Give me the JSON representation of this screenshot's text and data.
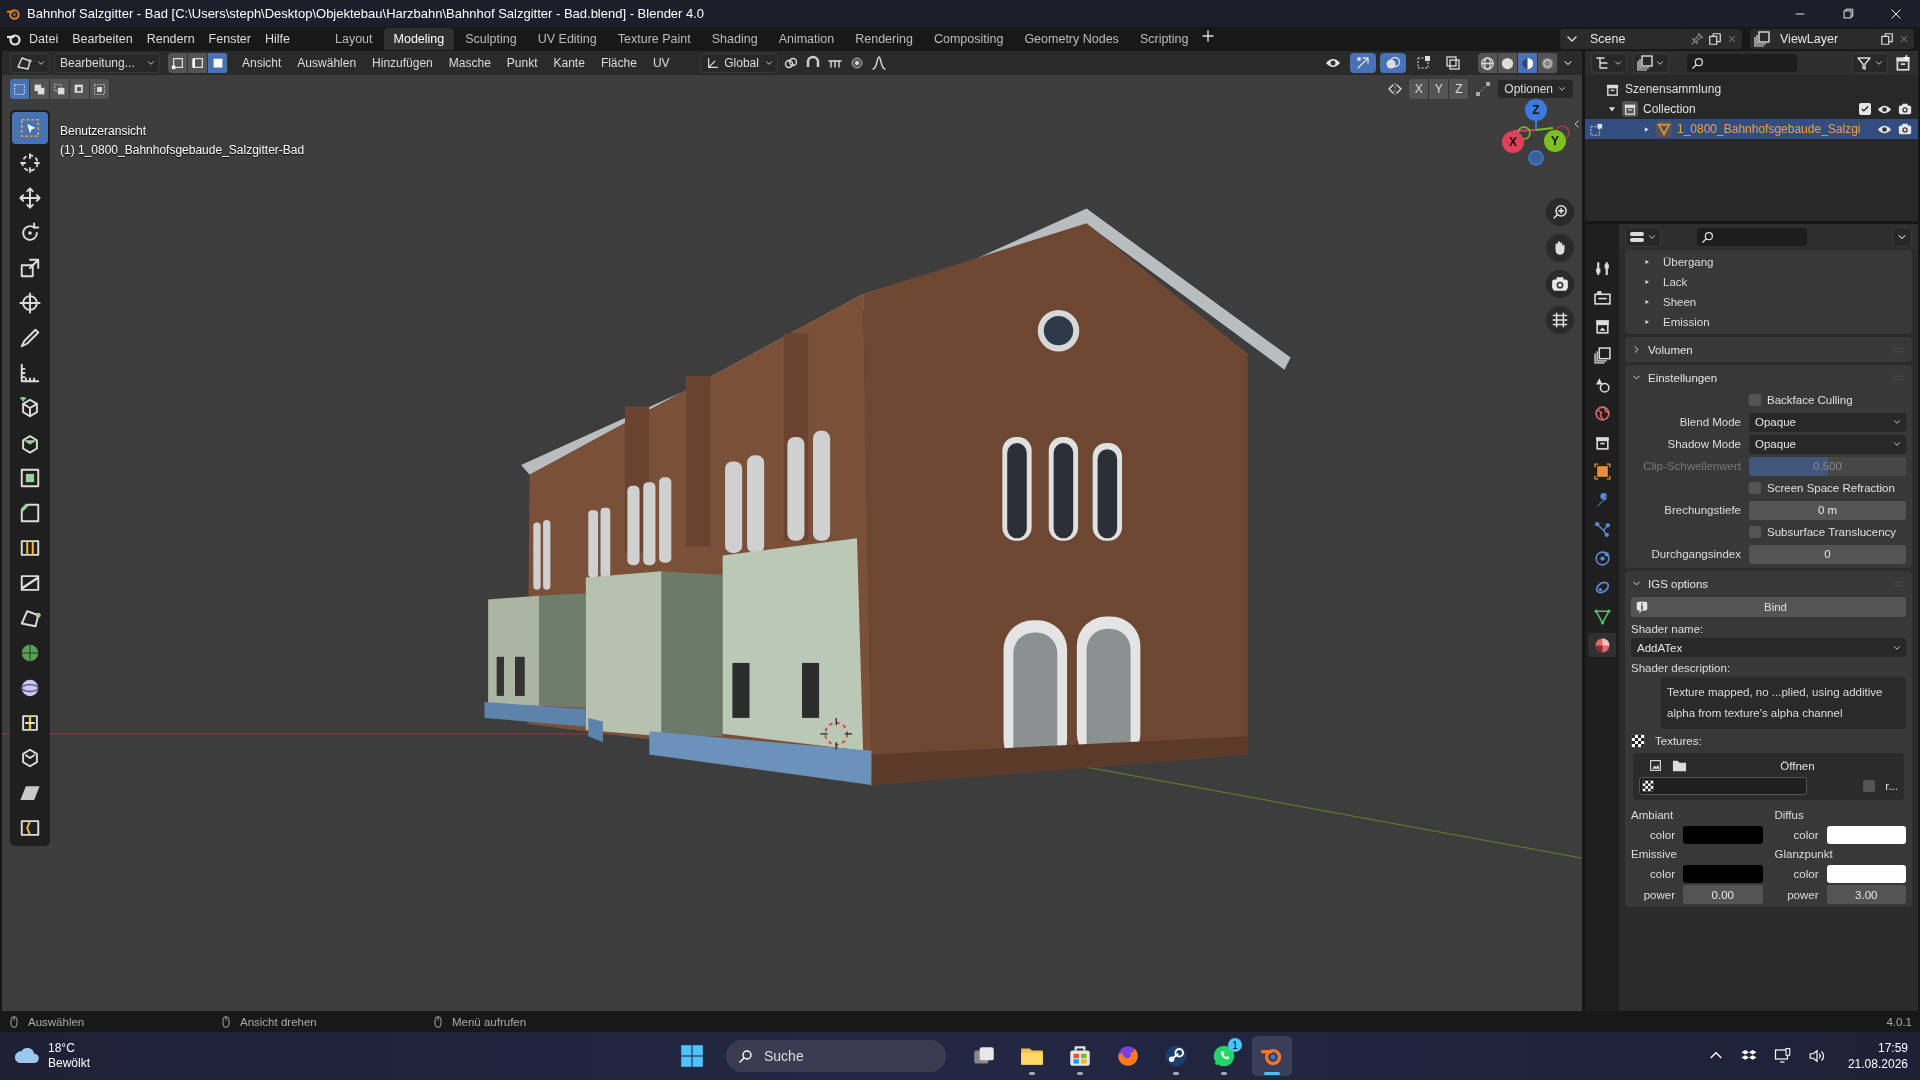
{
  "window": {
    "title": "Bahnhof Salzgitter - Bad [C:\\Users\\steph\\Desktop\\Objektebau\\Harzbahn\\Bahnhof Salzgitter - Bad.blend] - Blender 4.0"
  },
  "menu": [
    "Datei",
    "Bearbeiten",
    "Rendern",
    "Fenster",
    "Hilfe"
  ],
  "workspaces": [
    {
      "label": "Layout",
      "selected": false
    },
    {
      "label": "Modeling",
      "selected": true
    },
    {
      "label": "Sculpting",
      "selected": false
    },
    {
      "label": "UV Editing",
      "selected": false
    },
    {
      "label": "Texture Paint",
      "selected": false
    },
    {
      "label": "Shading",
      "selected": false
    },
    {
      "label": "Animation",
      "selected": false
    },
    {
      "label": "Rendering",
      "selected": false
    },
    {
      "label": "Compositing",
      "selected": false
    },
    {
      "label": "Geometry Nodes",
      "selected": false
    },
    {
      "label": "Scripting",
      "selected": false
    }
  ],
  "scene": "Scene",
  "view_layer": "ViewLayer",
  "header": {
    "mode": "Bearbeitung...",
    "select_modes": [
      {
        "kind": "vertex",
        "selected": false
      },
      {
        "kind": "edge",
        "selected": false
      },
      {
        "kind": "face",
        "selected": true
      }
    ],
    "menus": [
      "Ansicht",
      "Auswählen",
      "Hinzufügen",
      "Masche",
      "Punkt",
      "Kante",
      "Fläche",
      "UV"
    ],
    "orientation": "Global",
    "toggles": [
      {
        "kind": "visibility",
        "on": false
      },
      {
        "kind": "gizmo",
        "on": true
      },
      {
        "kind": "overlay",
        "on": true
      },
      {
        "kind": "select-type",
        "on": false
      },
      {
        "kind": "xray",
        "on": false
      }
    ],
    "shading": [
      {
        "kind": "wireframe",
        "selected": false
      },
      {
        "kind": "solid",
        "selected": false
      },
      {
        "kind": "material",
        "selected": true
      },
      {
        "kind": "rendered",
        "selected": false
      }
    ]
  },
  "viewport": {
    "box_modes": [
      {
        "selected": true
      },
      {
        "selected": false
      },
      {
        "selected": false
      },
      {
        "selected": false
      },
      {
        "selected": false
      }
    ],
    "axes": [
      "X",
      "Y",
      "Z"
    ],
    "options": "Optionen",
    "view_name": "Benutzeransicht",
    "object_label": "(1) 1_0800_Bahnhofsgebaude_Salzgitter-Bad",
    "gizmo": [
      {
        "label": "Z"
      },
      {
        "label": "X"
      },
      {
        "label": "Y"
      }
    ],
    "tools": [
      {
        "kind": "select",
        "selected": true
      },
      {
        "kind": "cursor",
        "selected": false
      },
      {
        "kind": "move",
        "selected": false
      },
      {
        "kind": "rotate",
        "selected": false
      },
      {
        "kind": "scale",
        "selected": false
      },
      {
        "kind": "transform",
        "selected": false
      },
      {
        "kind": "annotate",
        "selected": false
      },
      {
        "kind": "measure",
        "selected": false
      },
      {
        "kind": "add-cube",
        "selected": false
      },
      {
        "kind": "extrude",
        "selected": false
      },
      {
        "kind": "inset",
        "selected": false
      },
      {
        "kind": "bevel",
        "selected": false
      },
      {
        "kind": "loop-cut",
        "selected": false
      },
      {
        "kind": "knife",
        "selected": false
      },
      {
        "kind": "poly-build",
        "selected": false
      },
      {
        "kind": "spin",
        "selected": false
      },
      {
        "kind": "smooth",
        "selected": false
      },
      {
        "kind": "edge-slide",
        "selected": false
      },
      {
        "kind": "shrink",
        "selected": false
      },
      {
        "kind": "shear",
        "selected": false
      },
      {
        "kind": "rip",
        "selected": false
      }
    ]
  },
  "outliner": {
    "root": {
      "label": "Szenensammlung",
      "children": [
        {
          "label": "Collection",
          "selected": false,
          "expanded": true,
          "checked": true,
          "children": [
            {
              "label": "1_0800_Bahnhofsgebaude_Salzgi",
              "selected": true,
              "expanded": false
            }
          ]
        }
      ]
    }
  },
  "properties": {
    "tabs": [
      {
        "kind": "tool",
        "selected": false
      },
      {
        "kind": "render",
        "selected": false
      },
      {
        "kind": "output",
        "selected": false
      },
      {
        "kind": "view-layer",
        "selected": false
      },
      {
        "kind": "scene",
        "selected": false
      },
      {
        "kind": "world",
        "selected": false
      },
      {
        "kind": "collection",
        "selected": false
      },
      {
        "kind": "object",
        "selected": false
      },
      {
        "kind": "modifier",
        "selected": false
      },
      {
        "kind": "particles",
        "selected": false
      },
      {
        "kind": "physics",
        "selected": false
      },
      {
        "kind": "constraints",
        "selected": false
      },
      {
        "kind": "data",
        "selected": false
      },
      {
        "kind": "material",
        "selected": true
      }
    ],
    "subpanels": [
      "Übergang",
      "Lack",
      "Sheen",
      "Emission"
    ],
    "panels": [
      {
        "title": "Volumen",
        "expanded": false
      },
      {
        "title": "Einstellungen",
        "expanded": true,
        "rows": [
          {
            "kind": "checkbox",
            "label": "Backface Culling",
            "checked": false,
            "disabled": false
          },
          {
            "kind": "dropdown",
            "label": "Blend Mode",
            "value": "Opaque",
            "disabled": false
          },
          {
            "kind": "dropdown",
            "label": "Shadow Mode",
            "value": "Opaque",
            "disabled": false
          },
          {
            "kind": "slider",
            "label": "Clip-Schwellenwert",
            "value": "0.500",
            "level": 0.5,
            "disabled": true
          },
          {
            "kind": "checkbox",
            "label": "Screen Space Refraction",
            "checked": false,
            "disabled": false
          },
          {
            "kind": "number",
            "label": "Brechungstiefe",
            "value": "0 m",
            "disabled": false
          },
          {
            "kind": "checkbox",
            "label": "Subsurface Translucency",
            "checked": false,
            "disabled": false
          },
          {
            "kind": "number",
            "label": "Durchgangsindex",
            "value": "0",
            "disabled": false
          }
        ]
      }
    ],
    "igs": {
      "title": "IGS options",
      "expanded": true,
      "bind": "Bind",
      "shader_name_label": "Shader name:",
      "shader_name": "AddATex",
      "shader_description_label": "Shader description:",
      "shader_description": "Texture mapped, no ...plied, using additive alpha from texture's alpha channel",
      "textures_label": "Textures:",
      "open": "Öffnen",
      "texture_option": {
        "label": "r...",
        "checked": false
      },
      "colors": [
        {
          "title": "Ambiant",
          "rows": [
            {
              "kind": "color",
              "label": "color",
              "color": "#000000"
            }
          ]
        },
        {
          "title": "Diffus",
          "rows": [
            {
              "kind": "color",
              "label": "color",
              "color": "#ffffff"
            }
          ]
        },
        {
          "title": "Emissive",
          "rows": [
            {
              "kind": "color",
              "label": "color",
              "color": "#000000"
            },
            {
              "kind": "number",
              "label": "power",
              "value": "0.00"
            }
          ]
        },
        {
          "title": "Glanzpunkt",
          "rows": [
            {
              "kind": "color",
              "label": "color",
              "color": "#ffffff"
            },
            {
              "kind": "number",
              "label": "power",
              "value": "3.00"
            }
          ]
        }
      ]
    }
  },
  "status_bar": {
    "hints": [
      "Auswählen",
      "Ansicht drehen",
      "Menü aufrufen"
    ],
    "version": "4.0.1"
  },
  "taskbar": {
    "temperature": "18°C",
    "weather": "Bewölkt",
    "search": {
      "placeholder": "Suche"
    },
    "apps": [
      {
        "kind": "start",
        "running": false,
        "selected": false
      },
      {
        "kind": "task-view",
        "running": false,
        "selected": false
      },
      {
        "kind": "files",
        "running": true,
        "selected": false
      },
      {
        "kind": "store",
        "running": true,
        "selected": false
      },
      {
        "kind": "browser",
        "running": false,
        "selected": false
      },
      {
        "kind": "steam",
        "running": true,
        "selected": false
      },
      {
        "kind": "chat",
        "running": true,
        "selected": false,
        "badge": "1"
      },
      {
        "kind": "blender",
        "running": true,
        "selected": true
      }
    ],
    "time": "17:59",
    "date": "21.08.2026"
  }
}
